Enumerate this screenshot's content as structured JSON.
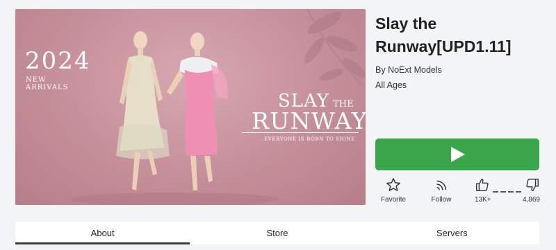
{
  "game": {
    "title": "Slay the Runway[UPD1.11]",
    "creator_prefix": "By ",
    "creator_name": "NoExt Models",
    "age_rating": "All Ages"
  },
  "thumbnail": {
    "year": "2024",
    "arrivals_line1": "NEW",
    "arrivals_line2": "ARRIVALS",
    "logo_slay": "SLAY",
    "logo_the": "THE",
    "logo_runway": "RUNWAY",
    "tagline": "EVERYONE IS BORN TO SHINE",
    "background_color": "#c58f9a"
  },
  "play_button": {
    "icon": "play-icon",
    "color": "#3aa64b"
  },
  "actions": {
    "favorite_label": "Favorite",
    "follow_label": "Follow",
    "upvotes": "13K+",
    "downvotes": "4,869"
  },
  "tabs": [
    {
      "label": "About",
      "active": true
    },
    {
      "label": "Store",
      "active": false
    },
    {
      "label": "Servers",
      "active": false
    }
  ]
}
